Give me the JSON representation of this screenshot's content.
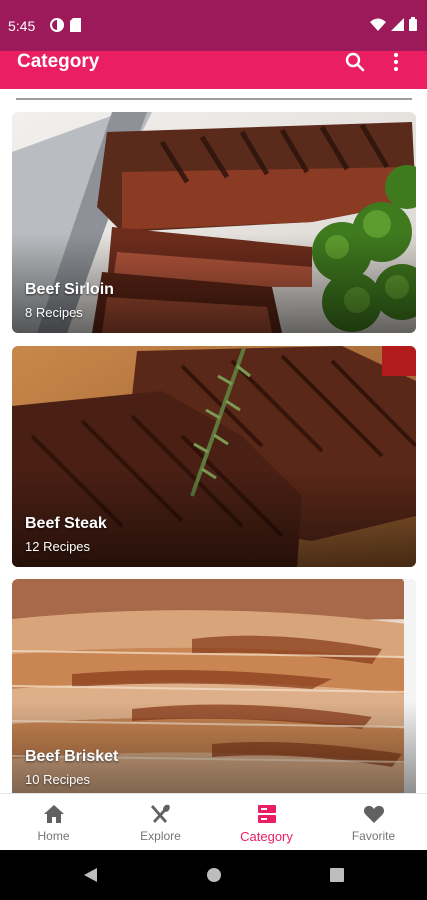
{
  "status_bar": {
    "time": "5:45"
  },
  "app_bar": {
    "title": "Category"
  },
  "categories": [
    {
      "name": "Beef Sirloin",
      "count": "8 Recipes"
    },
    {
      "name": "Beef Steak",
      "count": "12 Recipes"
    },
    {
      "name": "Beef Brisket",
      "count": "10 Recipes"
    }
  ],
  "bottom_nav": {
    "items": [
      {
        "label": "Home",
        "icon": "home-icon"
      },
      {
        "label": "Explore",
        "icon": "fork-knife-icon"
      },
      {
        "label": "Category",
        "icon": "category-list-icon"
      },
      {
        "label": "Favorite",
        "icon": "heart-icon"
      }
    ],
    "active": "Category"
  },
  "colors": {
    "primary": "#e91e63",
    "status_bar": "#9c1a5a",
    "inactive": "#757575"
  }
}
